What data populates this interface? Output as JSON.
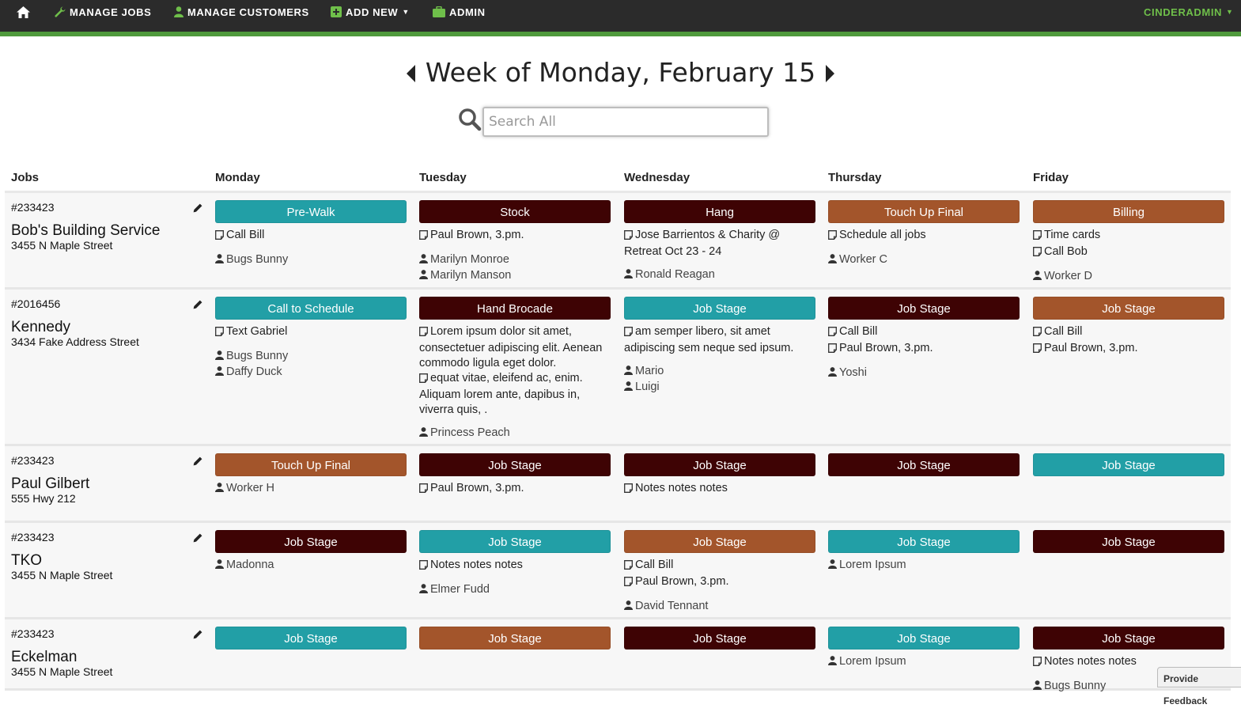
{
  "colors": {
    "teal": "#229fa6",
    "maroon": "#3e0304",
    "rust": "#a3552b",
    "nav_bg": "#2b2b2b",
    "nav_accent": "#4f9a3c"
  },
  "nav": {
    "home_icon": "home-icon",
    "items": [
      {
        "label": "MANAGE JOBS",
        "icon": "wrench-icon"
      },
      {
        "label": "MANAGE CUSTOMERS",
        "icon": "user-icon"
      },
      {
        "label": "ADD NEW",
        "icon": "plus-square-icon"
      },
      {
        "label": "ADMIN",
        "icon": "briefcase-icon"
      }
    ],
    "user": "CINDERADMIN"
  },
  "week_title": "Week of Monday, February 15",
  "search": {
    "placeholder": "Search All",
    "value": ""
  },
  "columns": [
    "Jobs",
    "Monday",
    "Tuesday",
    "Wednesday",
    "Thursday",
    "Friday"
  ],
  "rows": [
    {
      "id": "#233423",
      "name": "Bob's Building Service",
      "address": "3455 N Maple Street",
      "days": [
        {
          "stage": "Pre-Walk",
          "color": "teal",
          "notes": [
            "Call Bill"
          ],
          "people": [
            "Bugs Bunny"
          ]
        },
        {
          "stage": "Stock",
          "color": "maroon",
          "notes": [
            "Paul Brown, 3.pm."
          ],
          "people": [
            "Marilyn Monroe",
            "Marilyn Manson"
          ]
        },
        {
          "stage": "Hang",
          "color": "maroon",
          "notes": [
            "Jose Barrientos & Charity @ Retreat Oct 23 - 24"
          ],
          "people": [
            "Ronald Reagan"
          ]
        },
        {
          "stage": "Touch Up Final",
          "color": "rust",
          "notes": [
            "Schedule all jobs"
          ],
          "people": [
            "Worker C"
          ]
        },
        {
          "stage": "Billing",
          "color": "rust",
          "notes": [
            "Time cards",
            "Call Bob"
          ],
          "people": [
            "Worker D"
          ]
        }
      ]
    },
    {
      "id": "#2016456",
      "name": "Kennedy",
      "address": "3434 Fake Address Street",
      "days": [
        {
          "stage": "Call to Schedule",
          "color": "teal",
          "notes": [
            "Text Gabriel"
          ],
          "people": [
            "Bugs Bunny",
            "Daffy Duck"
          ]
        },
        {
          "stage": "Hand Brocade",
          "color": "maroon",
          "notes": [
            "Lorem ipsum dolor sit amet, consectetuer adipiscing elit. Aenean commodo ligula eget dolor.",
            "equat vitae, eleifend ac, enim. Aliquam lorem ante, dapibus in, viverra quis, ."
          ],
          "people": [
            "Princess Peach"
          ]
        },
        {
          "stage": "Job Stage",
          "color": "teal",
          "notes": [
            "am semper libero, sit amet adipiscing sem neque sed ipsum."
          ],
          "people": [
            "Mario",
            "Luigi"
          ]
        },
        {
          "stage": "Job Stage",
          "color": "maroon",
          "notes": [
            "Call Bill",
            "Paul Brown, 3.pm."
          ],
          "people": [
            "Yoshi"
          ]
        },
        {
          "stage": "Job Stage",
          "color": "rust",
          "notes": [
            "Call Bill",
            "Paul Brown, 3.pm."
          ],
          "people": []
        }
      ]
    },
    {
      "id": "#233423",
      "name": "Paul Gilbert",
      "address": "555 Hwy 212",
      "days": [
        {
          "stage": "Touch Up Final",
          "color": "rust",
          "notes": [],
          "people": [
            "Worker H"
          ]
        },
        {
          "stage": "Job Stage",
          "color": "maroon",
          "notes": [
            "Paul Brown, 3.pm."
          ],
          "people": []
        },
        {
          "stage": "Job Stage",
          "color": "maroon",
          "notes": [
            "Notes notes notes"
          ],
          "people": []
        },
        {
          "stage": "Job Stage",
          "color": "maroon",
          "notes": [],
          "people": []
        },
        {
          "stage": "Job Stage",
          "color": "teal",
          "notes": [],
          "people": []
        }
      ]
    },
    {
      "id": "#233423",
      "name": "TKO",
      "address": "3455 N Maple Street",
      "days": [
        {
          "stage": "Job Stage",
          "color": "maroon",
          "notes": [],
          "people": [
            "Madonna"
          ]
        },
        {
          "stage": "Job Stage",
          "color": "teal",
          "notes": [
            "Notes notes notes"
          ],
          "people": [
            "Elmer Fudd"
          ]
        },
        {
          "stage": "Job Stage",
          "color": "rust",
          "notes": [
            "Call Bill",
            "Paul Brown, 3.pm."
          ],
          "people": [
            "David Tennant"
          ]
        },
        {
          "stage": "Job Stage",
          "color": "teal",
          "notes": [],
          "people": [
            "Lorem Ipsum"
          ]
        },
        {
          "stage": "Job Stage",
          "color": "maroon",
          "notes": [],
          "people": []
        }
      ]
    },
    {
      "id": "#233423",
      "name": "Eckelman",
      "address": "3455 N Maple Street",
      "days": [
        {
          "stage": "Job Stage",
          "color": "teal",
          "notes": [],
          "people": []
        },
        {
          "stage": "Job Stage",
          "color": "rust",
          "notes": [],
          "people": []
        },
        {
          "stage": "Job Stage",
          "color": "maroon",
          "notes": [],
          "people": []
        },
        {
          "stage": "Job Stage",
          "color": "teal",
          "notes": [],
          "people": [
            "Lorem Ipsum"
          ]
        },
        {
          "stage": "Job Stage",
          "color": "maroon",
          "notes": [
            "Notes notes notes"
          ],
          "people": [
            "Bugs Bunny"
          ]
        }
      ]
    }
  ],
  "feedback_label": "Provide Feedback"
}
